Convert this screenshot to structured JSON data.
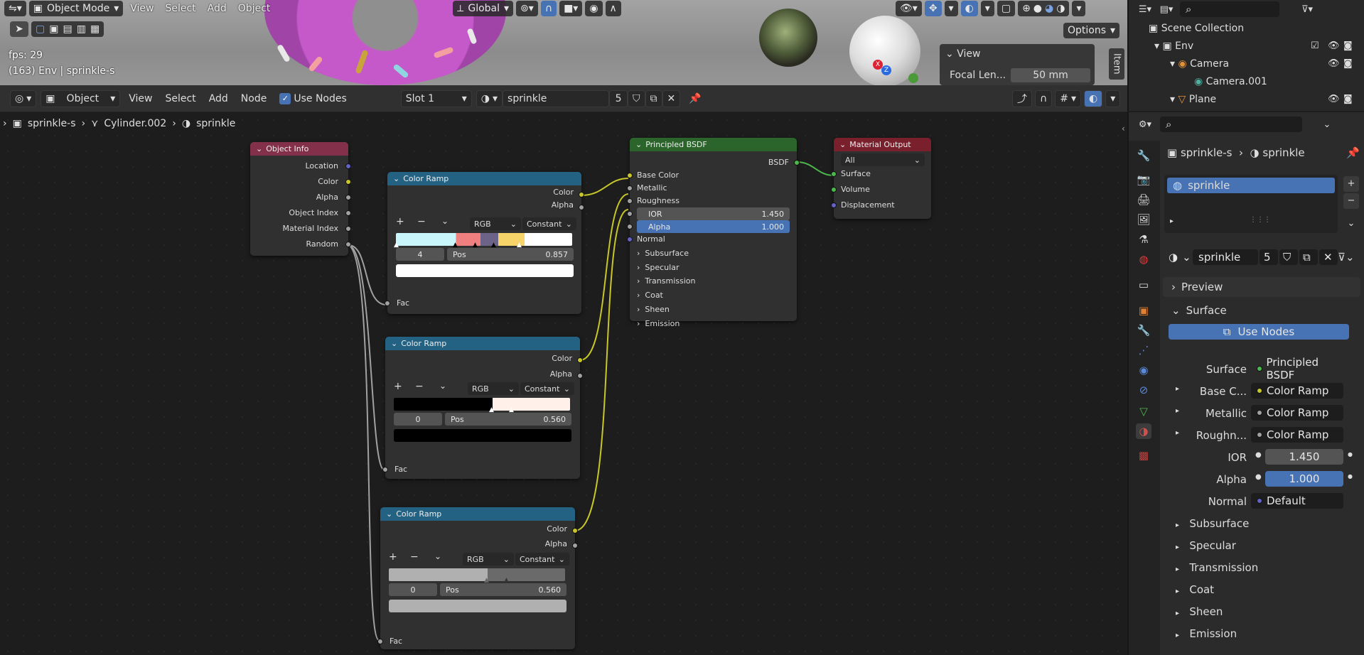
{
  "viewport": {
    "mode": "Object Mode",
    "menus": [
      "View",
      "Select",
      "Add",
      "Object"
    ],
    "transform": "Global",
    "options": "Options",
    "fps": "fps: 29",
    "info": "(163) Env | sprinkle-s",
    "npanel_title": "View",
    "npanel_focal_label": "Focal Len...",
    "npanel_focal_value": "50 mm",
    "npanel_tab": "Item"
  },
  "node_header": {
    "editor_type": "Object",
    "menus": [
      "View",
      "Select",
      "Add",
      "Node"
    ],
    "use_nodes": "Use Nodes",
    "slot": "Slot 1",
    "material": "sprinkle",
    "users": "5"
  },
  "breadcrumb": [
    "sprinkle-s",
    "Cylinder.002",
    "sprinkle"
  ],
  "nodes": {
    "object_info": {
      "title": "Object Info",
      "outputs": [
        "Location",
        "Color",
        "Alpha",
        "Object Index",
        "Material Index",
        "Random"
      ]
    },
    "ramp1": {
      "title": "Color Ramp",
      "out_color": "Color",
      "out_alpha": "Alpha",
      "mode": "RGB",
      "interp": "Constant",
      "index": "4",
      "pos_label": "Pos",
      "pos": "0.857",
      "input": "Fac"
    },
    "ramp2": {
      "title": "Color Ramp",
      "out_color": "Color",
      "out_alpha": "Alpha",
      "mode": "RGB",
      "interp": "Constant",
      "index": "0",
      "pos_label": "Pos",
      "pos": "0.560",
      "input": "Fac"
    },
    "ramp3": {
      "title": "Color Ramp",
      "out_color": "Color",
      "out_alpha": "Alpha",
      "mode": "RGB",
      "interp": "Constant",
      "index": "0",
      "pos_label": "Pos",
      "pos": "0.560",
      "input": "Fac"
    },
    "bsdf": {
      "title": "Principled BSDF",
      "output": "BSDF",
      "inputs": [
        "Base Color",
        "Metallic",
        "Roughness"
      ],
      "ior_label": "IOR",
      "ior": "1.450",
      "alpha_label": "Alpha",
      "alpha": "1.000",
      "normal": "Normal",
      "panels": [
        "Subsurface",
        "Specular",
        "Transmission",
        "Coat",
        "Sheen",
        "Emission"
      ]
    },
    "output": {
      "title": "Material Output",
      "target": "All",
      "inputs": [
        "Surface",
        "Volume",
        "Displacement"
      ]
    }
  },
  "outliner": {
    "title": "Scene Collection",
    "items": [
      "Env",
      "Camera",
      "Camera.001",
      "Plane"
    ]
  },
  "properties": {
    "breadcrumb_obj": "sprinkle-s",
    "breadcrumb_mat": "sprinkle",
    "slot_name": "sprinkle",
    "material": "sprinkle",
    "users": "5",
    "preview": "Preview",
    "surface": "Surface",
    "use_nodes": "Use Nodes",
    "surface_label": "Surface",
    "surface_value": "Principled BSDF",
    "rows": [
      {
        "label": "Base C...",
        "value": "Color Ramp"
      },
      {
        "label": "Metallic",
        "value": "Color Ramp"
      },
      {
        "label": "Roughn...",
        "value": "Color Ramp"
      }
    ],
    "ior_label": "IOR",
    "ior": "1.450",
    "alpha_label": "Alpha",
    "alpha": "1.000",
    "normal_label": "Normal",
    "normal": "Default",
    "subpanels": [
      "Subsurface",
      "Specular",
      "Transmission",
      "Coat",
      "Sheen",
      "Emission"
    ]
  },
  "colors": {
    "accent": "#4772b3",
    "object_info_header": "#83314a",
    "ramp_header": "#246283",
    "bsdf_header": "#2b652b",
    "output_header": "#7a1f2c"
  }
}
